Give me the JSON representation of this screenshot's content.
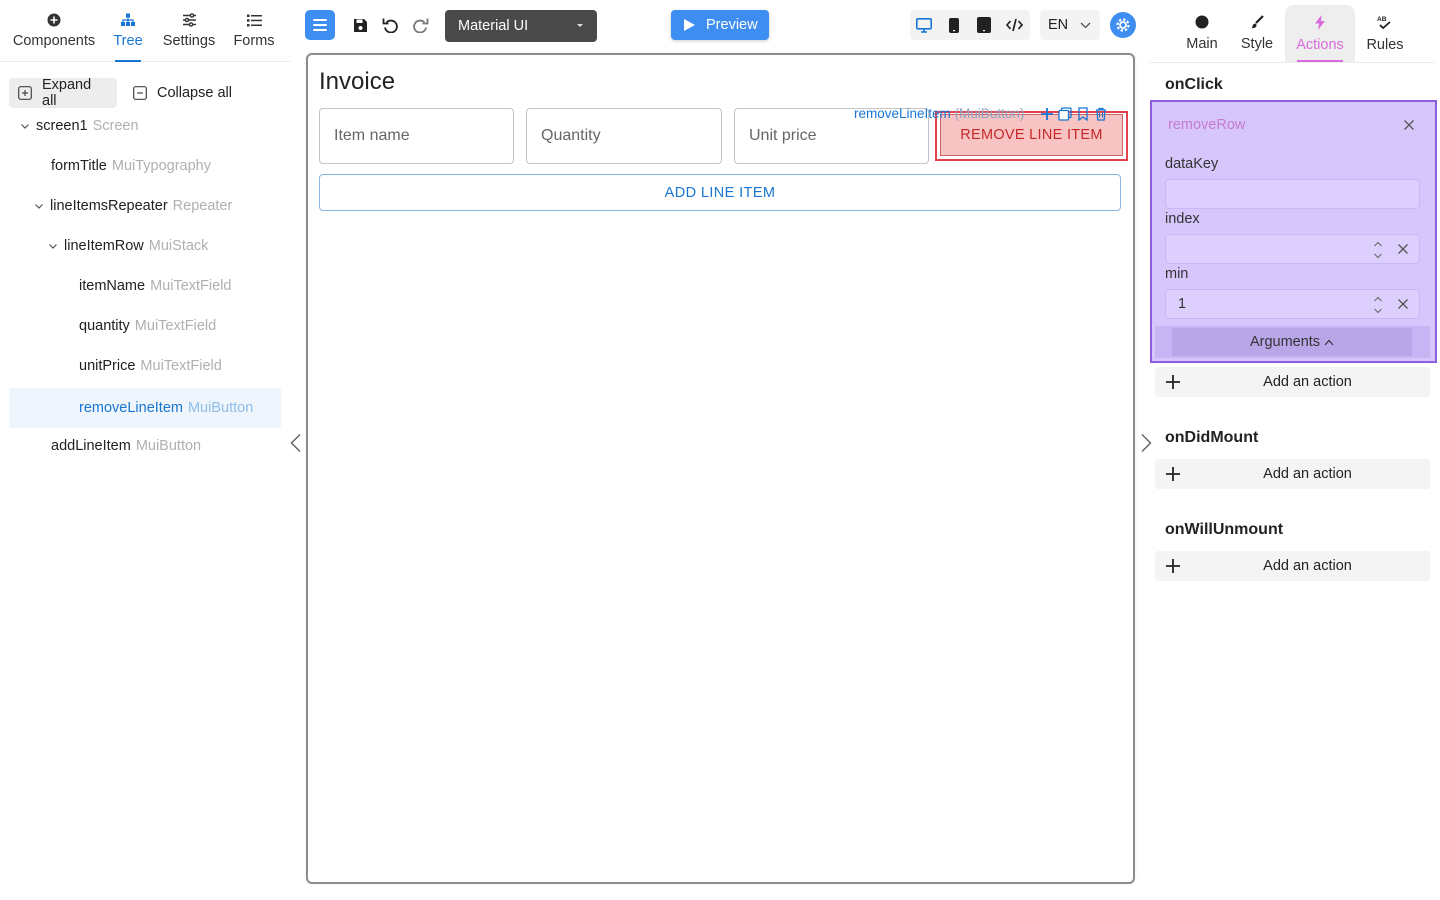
{
  "left_tabs": [
    {
      "label": "Components",
      "icon": "plus-circle-icon"
    },
    {
      "label": "Tree",
      "icon": "tree-icon"
    },
    {
      "label": "Settings",
      "icon": "sliders-icon"
    },
    {
      "label": "Forms",
      "icon": "list-icon"
    }
  ],
  "tree_controls": {
    "expand_all": "Expand all",
    "collapse_all": "Collapse all"
  },
  "tree": [
    {
      "name": "screen1",
      "type": "Screen"
    },
    {
      "name": "formTitle",
      "type": "MuiTypography"
    },
    {
      "name": "lineItemsRepeater",
      "type": "Repeater"
    },
    {
      "name": "lineItemRow",
      "type": "MuiStack"
    },
    {
      "name": "itemName",
      "type": "MuiTextField"
    },
    {
      "name": "quantity",
      "type": "MuiTextField"
    },
    {
      "name": "unitPrice",
      "type": "MuiTextField"
    },
    {
      "name": "removeLineItem",
      "type": "MuiButton"
    },
    {
      "name": "addLineItem",
      "type": "MuiButton"
    }
  ],
  "toolbar": {
    "theme_select": "Material UI",
    "preview": "Preview",
    "language": "EN"
  },
  "canvas": {
    "title": "Invoice",
    "fields": [
      "Item name",
      "Quantity",
      "Unit price"
    ],
    "remove_button": "REMOVE LINE ITEM",
    "add_button": "ADD LINE ITEM",
    "selection_label_name": "removeLineItem",
    "selection_label_type": "(MuiButton)"
  },
  "right_tabs": [
    {
      "label": "Main",
      "icon": "circle-icon"
    },
    {
      "label": "Style",
      "icon": "brush-icon"
    },
    {
      "label": "Actions",
      "icon": "bolt-icon"
    },
    {
      "label": "Rules",
      "icon": "rules-icon"
    }
  ],
  "events": {
    "on_click": "onClick",
    "on_did_mount": "onDidMount",
    "on_will_unmount": "onWillUnmount"
  },
  "action": {
    "name": "removeRow",
    "label_datakey": "dataKey",
    "label_index": "index",
    "label_min": "min",
    "value_datakey": "",
    "value_index": "",
    "value_min": "1",
    "arguments": "Arguments"
  },
  "add_action_label": "Add an action",
  "colors": {
    "accent": "#1976d2",
    "actions_tab": "#d86cdd",
    "action_box": "#d6c6fb",
    "remove_button": "#f7c3c3"
  }
}
